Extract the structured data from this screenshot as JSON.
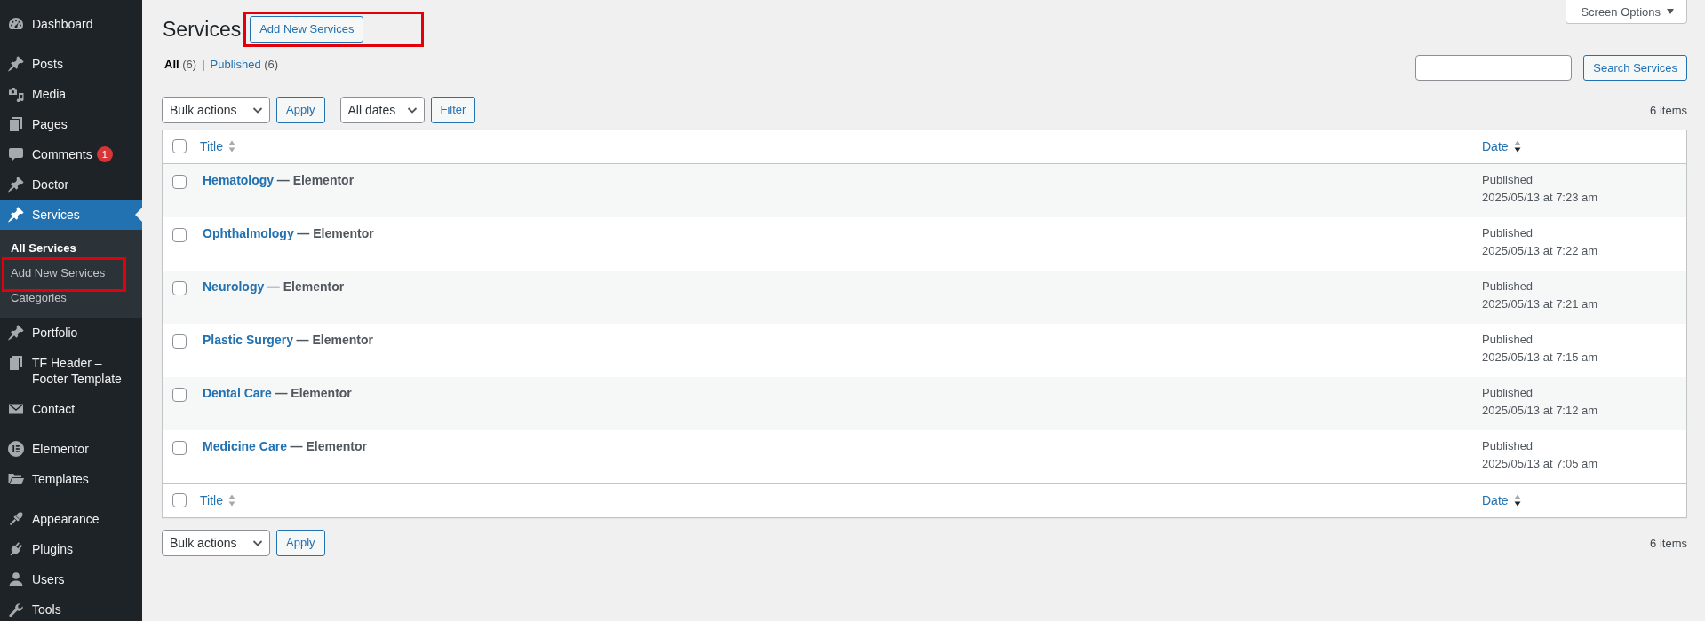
{
  "sidebar": {
    "menu_groups": [
      {
        "items": [
          {
            "label": "Dashboard",
            "selected": false
          }
        ]
      },
      {
        "items": [
          {
            "label": "Posts",
            "selected": false
          },
          {
            "label": "Media",
            "selected": false
          },
          {
            "label": "Pages",
            "selected": false
          },
          {
            "label": "Comments",
            "selected": false,
            "badge": "1"
          },
          {
            "label": "Doctor",
            "selected": false
          },
          {
            "label": "Services",
            "selected": true,
            "children": [
              {
                "label": "All Services",
                "selected": true,
                "highlighted": false
              },
              {
                "label": "Add New Services",
                "selected": false,
                "highlighted": true
              },
              {
                "label": "Categories",
                "selected": false,
                "highlighted": false
              }
            ]
          },
          {
            "label": "Portfolio",
            "selected": false
          },
          {
            "label": "TF Header – Footer Template",
            "selected": false
          },
          {
            "label": "Contact",
            "selected": false
          }
        ]
      },
      {
        "items": [
          {
            "label": "Elementor",
            "selected": false
          },
          {
            "label": "Templates",
            "selected": false
          }
        ]
      },
      {
        "items": [
          {
            "label": "Appearance",
            "selected": false
          },
          {
            "label": "Plugins",
            "selected": false
          },
          {
            "label": "Users",
            "selected": false
          },
          {
            "label": "Tools",
            "selected": false
          }
        ]
      }
    ]
  },
  "screen_options": {
    "label": "Screen Options"
  },
  "header": {
    "title": "Services",
    "add_button": {
      "label": "Add New Services",
      "highlighted": true
    }
  },
  "views": {
    "separator": "|",
    "items": [
      {
        "label": "All",
        "count": "(6)",
        "selected": true
      },
      {
        "label": "Published",
        "count": "(6)",
        "selected": false
      }
    ]
  },
  "search": {
    "button": "Search Services"
  },
  "top_nav": {
    "bulk_select": "Bulk actions",
    "apply_button": "Apply",
    "date_select": "All dates",
    "filter_button": "Filter",
    "count": "6 items"
  },
  "table": {
    "header_checked": false,
    "columns": [
      {
        "label": "Title",
        "sort_up": false,
        "sort_down": false
      },
      {
        "label": "Date",
        "sort_up": false,
        "sort_down": true
      }
    ],
    "rows": [
      {
        "title": "Hematology",
        "post_state": "— Elementor",
        "status": "Published",
        "date": "2025/05/13 at 7:23 am",
        "checked": false
      },
      {
        "title": "Ophthalmology",
        "post_state": "— Elementor",
        "status": "Published",
        "date": "2025/05/13 at 7:22 am",
        "checked": false
      },
      {
        "title": "Neurology",
        "post_state": "— Elementor",
        "status": "Published",
        "date": "2025/05/13 at 7:21 am",
        "checked": false
      },
      {
        "title": "Plastic Surgery",
        "post_state": "— Elementor",
        "status": "Published",
        "date": "2025/05/13 at 7:15 am",
        "checked": false
      },
      {
        "title": "Dental Care",
        "post_state": "— Elementor",
        "status": "Published",
        "date": "2025/05/13 at 7:12 am",
        "checked": false
      },
      {
        "title": "Medicine Care",
        "post_state": "— Elementor",
        "status": "Published",
        "date": "2025/05/13 at 7:05 am",
        "checked": false
      }
    ],
    "footer_checked": false,
    "footer_columns": [
      {
        "label": "Title",
        "sort_up": false,
        "sort_down": false
      },
      {
        "label": "Date",
        "sort_up": false,
        "sort_down": true
      }
    ]
  },
  "bottom_nav": {
    "bulk_select": "Bulk actions",
    "apply_button": "Apply",
    "count": "6 items"
  }
}
